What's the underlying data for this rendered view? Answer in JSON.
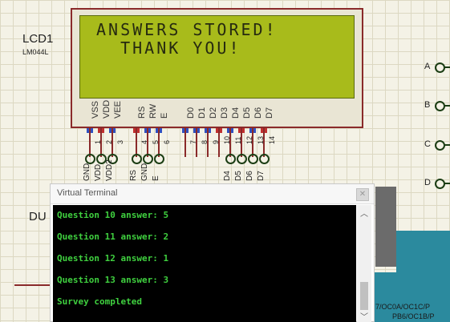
{
  "schematic": {
    "lcd_ref": "LCD1",
    "lcd_part": "LM044L",
    "du_label": "DU",
    "lcd_display": {
      "line1": "ANSWERS STORED!",
      "line2": "  THANK YOU!"
    },
    "lcd_pins": [
      "VSS",
      "VDD",
      "VEE",
      "RS",
      "RW",
      "E",
      "D0",
      "D1",
      "D2",
      "D3",
      "D4",
      "D5",
      "D6",
      "D7"
    ],
    "lcd_pin_numbers": [
      "1",
      "2",
      "3",
      "4",
      "5",
      "6",
      "7",
      "8",
      "9",
      "10",
      "11",
      "12",
      "13",
      "14"
    ],
    "bottom_pin_labels": [
      "GND",
      "VDD",
      "VDD2",
      "RS",
      "GND",
      "E",
      "D4",
      "D5",
      "D6",
      "D7"
    ],
    "port_labels": [
      "A",
      "B",
      "C",
      "D"
    ],
    "mcu_pins": [
      "7/OC0A/OC1C/P",
      "PB6/OC1B/P"
    ],
    "colors": {
      "lcd_screen": "#a8bb1b",
      "lcd_frame": "#8a2a2a",
      "terminal_text": "#3fd03f",
      "terminal_bg": "#000000"
    }
  },
  "virtual_terminal": {
    "title": "Virtual Terminal",
    "lines": [
      "Question 10 answer: 5",
      "Question 11 answer: 2",
      "Question 12 answer: 1",
      "Question 13 answer: 3",
      "Survey completed"
    ],
    "scroll_up_icon": "chevron-up-icon",
    "scroll_down_icon": "chevron-down-icon"
  }
}
